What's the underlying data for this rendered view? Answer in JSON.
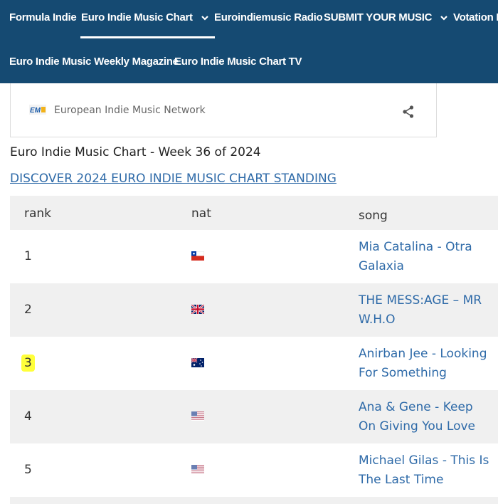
{
  "nav": {
    "row1": [
      {
        "label": "Formula Indie",
        "has_dropdown": false
      },
      {
        "label": "Euro Indie Music Chart",
        "has_dropdown": true,
        "active": true
      },
      {
        "label": "Euroindiemusic Radio",
        "has_dropdown": false
      },
      {
        "label": "SUBMIT YOUR MUSIC",
        "has_dropdown": true
      },
      {
        "label": "Votation P",
        "has_dropdown": false
      }
    ],
    "row2": [
      {
        "label": "Euro Indie Music Weekly Magazine"
      },
      {
        "label": "Euro Indie Music Chart TV"
      }
    ]
  },
  "embed": {
    "network_name": "European Indie Music Network",
    "logo_icon": "emn-logo-icon",
    "share_icon": "share-icon"
  },
  "week_title": "Euro Indie Music Chart - Week 36 of 2024",
  "discover_link": "DISCOVER 2024 EURO INDIE MUSIC CHART STANDING",
  "table": {
    "headers": {
      "rank": "rank",
      "nat": "nat",
      "song": "song"
    },
    "rows": [
      {
        "rank": "1",
        "nat": "chile-flag-icon",
        "song": "Mia Catalina - Otra Galaxia"
      },
      {
        "rank": "2",
        "nat": "uk-flag-icon",
        "song": "THE MESS:AGE – MR W.H.O"
      },
      {
        "rank": "3",
        "nat": "australia-flag-icon",
        "song": "Anirban Jee - Looking For Something",
        "highlighted": true
      },
      {
        "rank": "4",
        "nat": "usa-flag-icon",
        "song": "Ana & Gene - Keep On Giving You Love"
      },
      {
        "rank": "5",
        "nat": "usa-flag-icon",
        "song": "Michael Gilas - This Is The Last Time"
      }
    ]
  },
  "colors": {
    "nav_bg": "#154a72",
    "link": "#2e6aa8",
    "row_alt": "#f0f0f0",
    "highlight": "#ffff3a"
  }
}
